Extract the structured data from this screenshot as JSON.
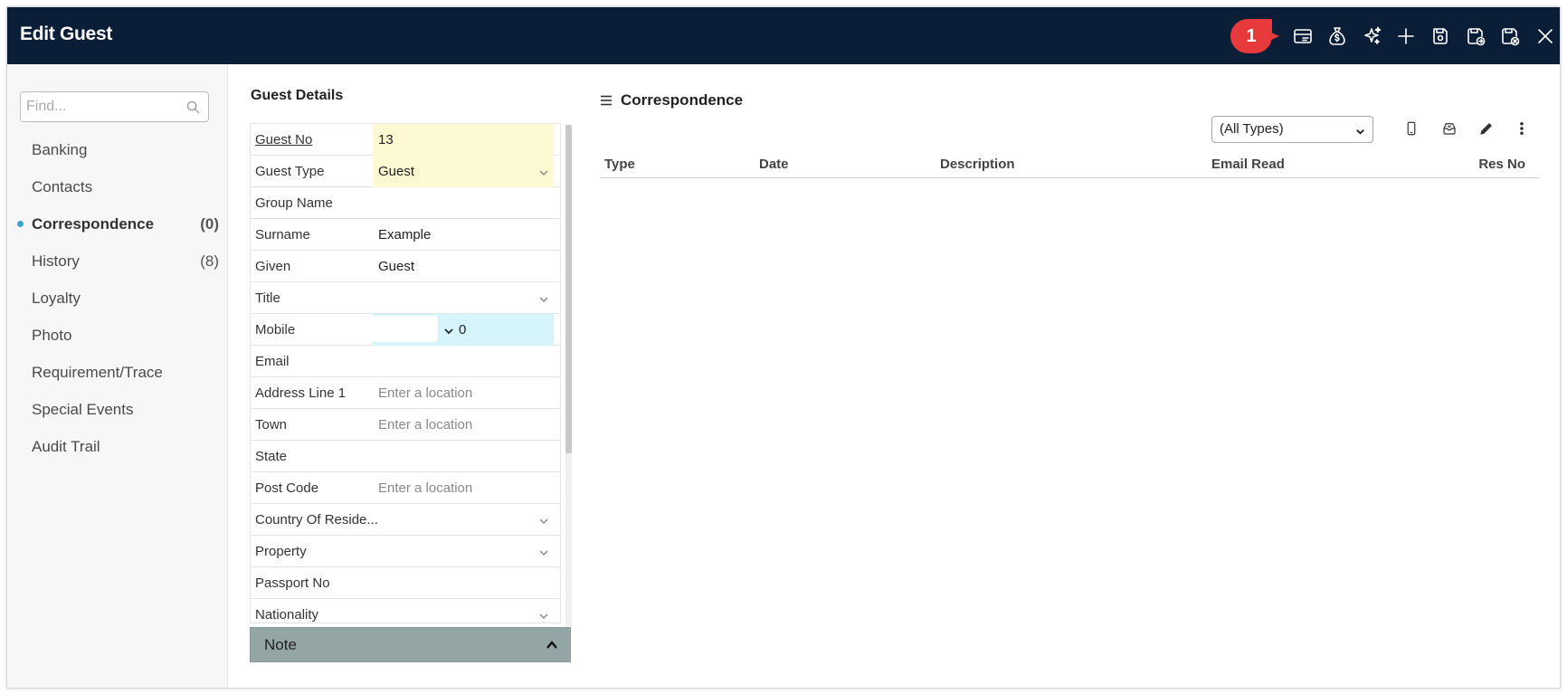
{
  "window": {
    "title": "Edit Guest",
    "toolbar_icons": [
      "card-icon",
      "money-bag-icon",
      "sparkle-icon",
      "plus-icon",
      "save-icon",
      "save-export-icon",
      "save-close-icon",
      "close-icon"
    ],
    "badge": "1",
    "badge_color": "#e8393c",
    "titlebar_color": "#0b1e38"
  },
  "sidebar": {
    "search_placeholder": "Find...",
    "items": [
      {
        "label": "Banking",
        "count": ""
      },
      {
        "label": "Contacts",
        "count": ""
      },
      {
        "label": "Correspondence",
        "count": "(0)",
        "active": true
      },
      {
        "label": "History",
        "count": "(8)"
      },
      {
        "label": "Loyalty",
        "count": ""
      },
      {
        "label": "Photo",
        "count": ""
      },
      {
        "label": "Requirement/Trace",
        "count": ""
      },
      {
        "label": "Special Events",
        "count": ""
      },
      {
        "label": "Audit Trail",
        "count": ""
      }
    ]
  },
  "guest_details": {
    "title": "Guest Details",
    "fields": [
      {
        "label": "Guest No",
        "value": "13"
      },
      {
        "label": "Guest Type",
        "value": "Guest"
      },
      {
        "label": "Group Name",
        "value": ""
      },
      {
        "label": "Surname",
        "value": "Example"
      },
      {
        "label": "Given",
        "value": "Guest"
      },
      {
        "label": "Title",
        "value": ""
      },
      {
        "label": "Mobile",
        "value": "0"
      },
      {
        "label": "Email",
        "value": ""
      },
      {
        "label": "Address Line 1",
        "placeholder": "Enter a location"
      },
      {
        "label": "Town",
        "placeholder": "Enter a location"
      },
      {
        "label": "State",
        "value": ""
      },
      {
        "label": "Post Code",
        "placeholder": "Enter a location"
      },
      {
        "label": "Country Of Reside...",
        "value": ""
      },
      {
        "label": "Property",
        "value": ""
      },
      {
        "label": "Passport No",
        "value": ""
      },
      {
        "label": "Nationality",
        "value": ""
      }
    ],
    "note_label": "Note"
  },
  "correspondence": {
    "title": "Correspondence",
    "type_filter": "(All Types)",
    "actions": [
      "mobile-icon",
      "inbox-icon",
      "pencil-icon",
      "more-vertical-icon"
    ],
    "columns": [
      "Type",
      "Date",
      "Description",
      "Email Read",
      "Res No"
    ]
  }
}
